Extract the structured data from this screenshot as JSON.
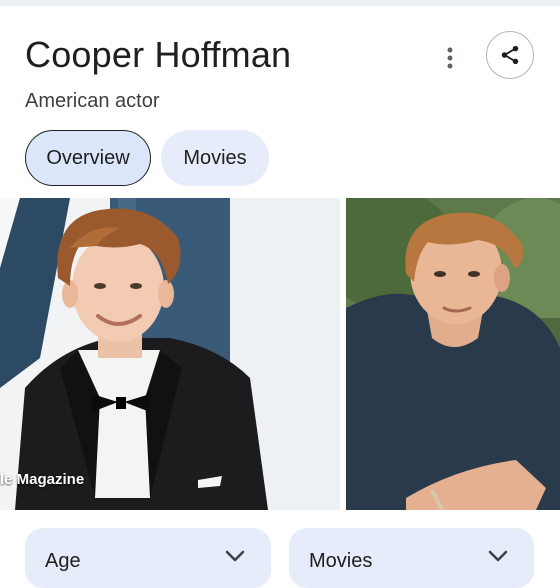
{
  "header": {
    "title": "Cooper Hoffman",
    "subtitle": "American actor",
    "more_icon": "more-vert-icon",
    "share_icon": "share-icon"
  },
  "tabs": [
    {
      "label": "Overview",
      "selected": true
    },
    {
      "label": "Movies",
      "selected": false
    }
  ],
  "images": [
    {
      "caption": "le Magazine"
    },
    {
      "caption": ""
    }
  ],
  "facts": [
    {
      "label": "Age",
      "icon": "chevron-down-icon"
    },
    {
      "label": "Movies",
      "icon": "chevron-down-icon"
    }
  ],
  "colors": {
    "chip_selected_bg": "#dce6fb",
    "chip_bg": "#e7ecfa",
    "card_bg": "#e6ecfa",
    "share_border": "#aab5c8"
  }
}
